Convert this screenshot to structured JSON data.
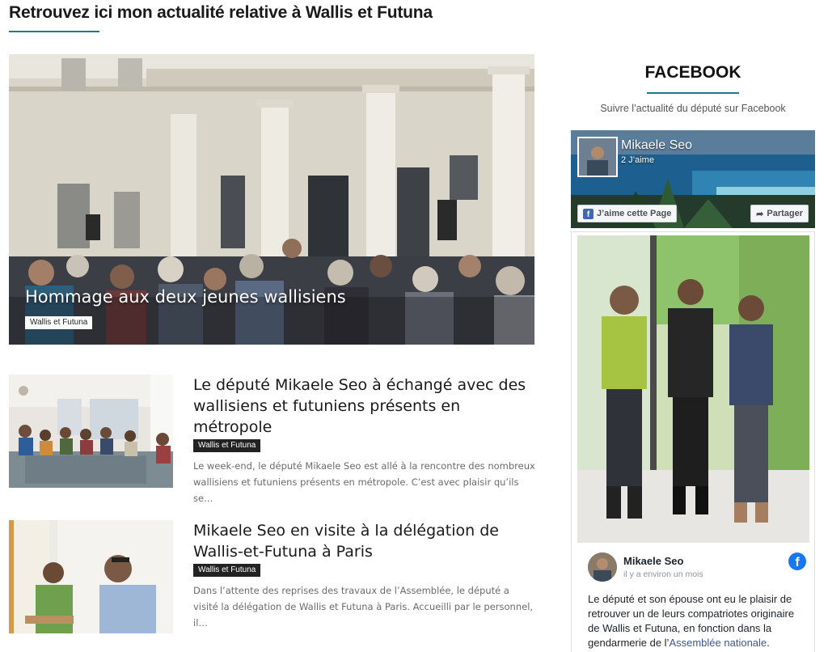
{
  "header": {
    "title": "Retrouvez ici mon actualité relative à Wallis et Futuna"
  },
  "hero": {
    "title": "Hommage aux deux jeunes wallisiens",
    "tag": "Wallis et Futuna"
  },
  "articles": [
    {
      "title": "Le député Mikaele Seo à échangé avec des wallisiens et futuniens présents en métropole",
      "tag": "Wallis et Futuna",
      "excerpt": "Le week-end, le député Mikaele Seo est allé à la rencontre des nombreux wallisiens et futuniens présents en métropole. C’est avec plaisir qu’ils se…"
    },
    {
      "title": "Mikaele Seo en visite à la délégation de Wallis-et-Futuna à Paris",
      "tag": "Wallis et Futuna",
      "excerpt": "Dans l’attente des reprises des travaux de l’Assemblée, le député a visité la délégation de Wallis et Futuna à Paris.  Accueilli par le personnel, il…"
    }
  ],
  "sidebar": {
    "heading": "FACEBOOK",
    "subtitle": "Suivre l’actualité du député sur Facebook",
    "page": {
      "name": "Mikaele Seo",
      "likes": "2 J’aime",
      "like_button": "J’aime cette Page",
      "share_button": "Partager"
    },
    "post": {
      "author": "Mikaele Seo",
      "time": "il y a environ un mois",
      "text_before_link": "Le député et son épouse ont eu le plaisir de retrouver un de leurs compatriotes originaire de Wallis et Futuna, en fonction dans la gendarmerie de l’",
      "link_text": "Assemblée nationale",
      "text_after_link": "."
    }
  },
  "colors": {
    "accent": "#1c7c8c",
    "tag_bg": "#222222",
    "facebook_blue": "#1877f2",
    "link": "#385898"
  }
}
